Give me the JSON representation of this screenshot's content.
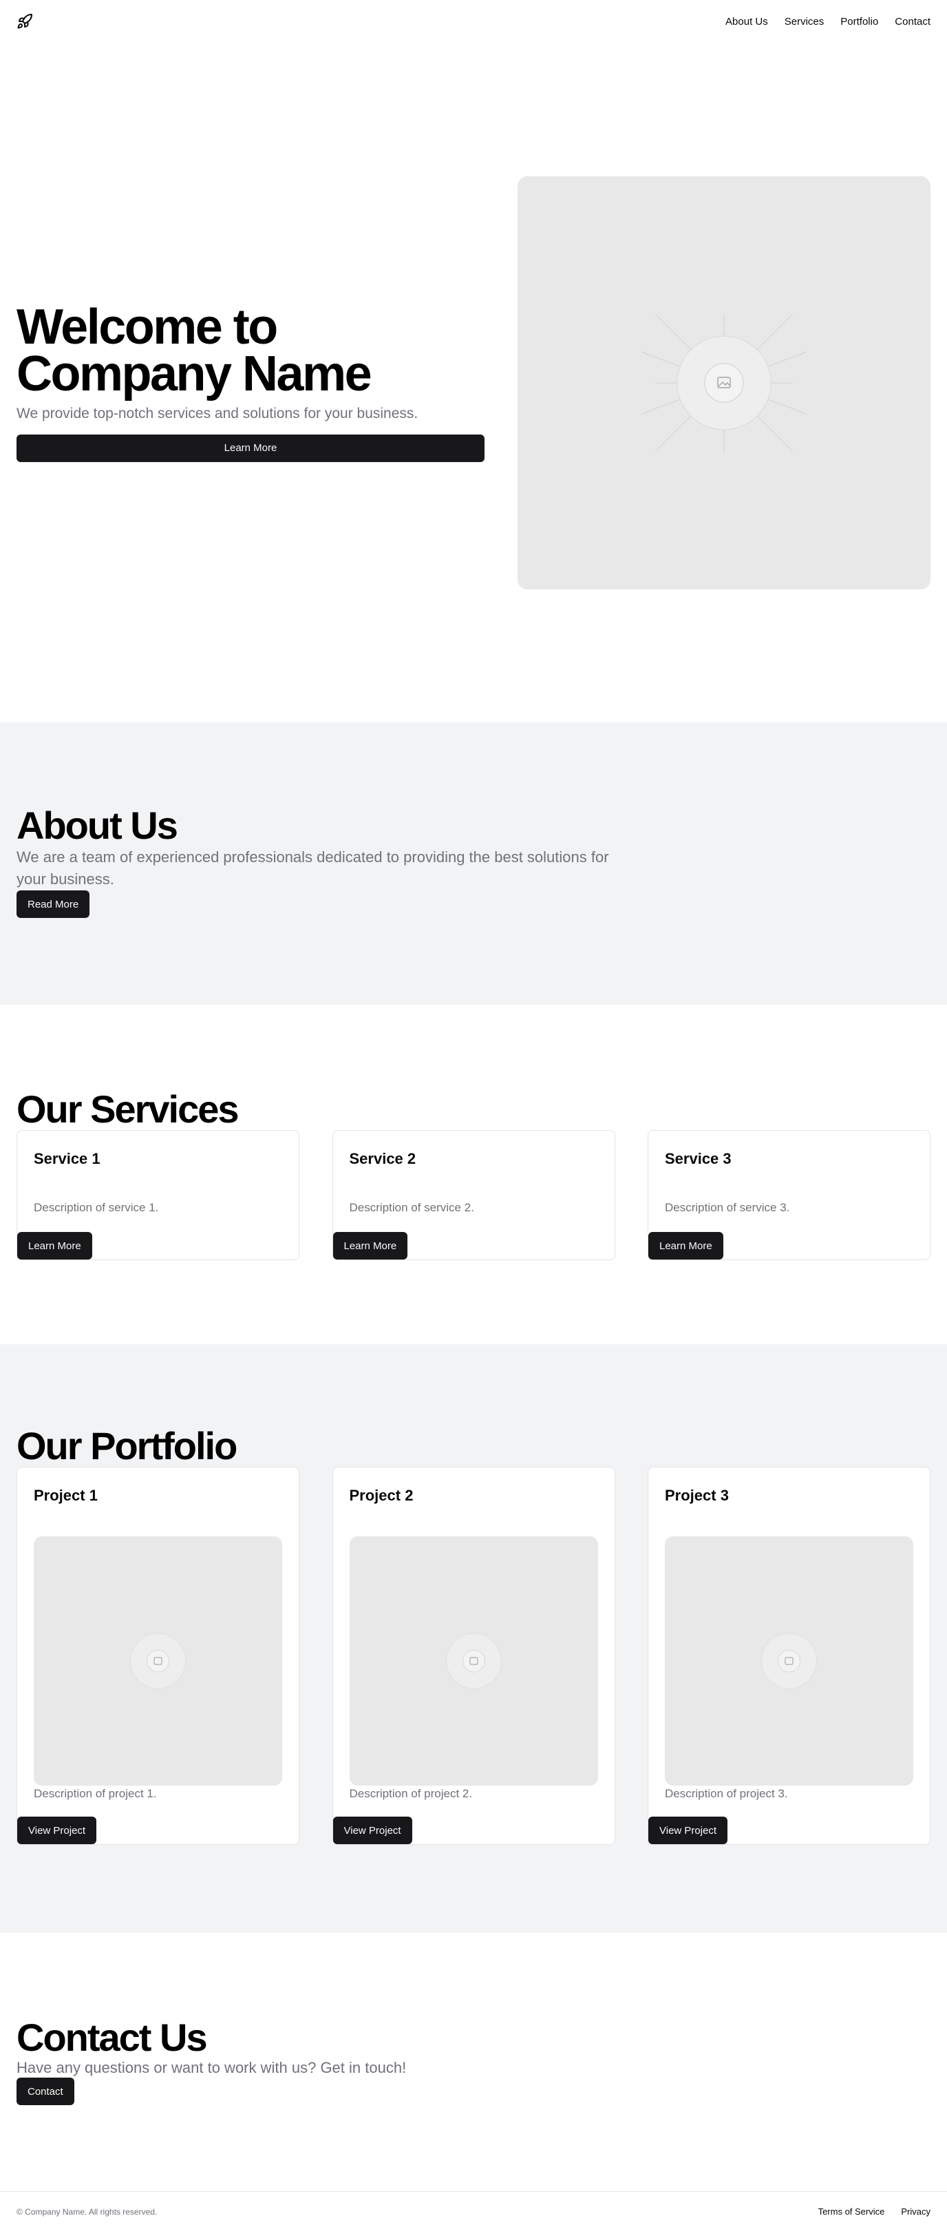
{
  "nav": {
    "items": [
      {
        "label": "About Us"
      },
      {
        "label": "Services"
      },
      {
        "label": "Portfolio"
      },
      {
        "label": "Contact"
      }
    ]
  },
  "hero": {
    "title": "Welcome to Company Name",
    "subtitle": "We provide top-notch services and solutions for your business.",
    "button": "Learn More",
    "image_icon": "image-placeholder-icon"
  },
  "about": {
    "title": "About Us",
    "text": "We are a team of experienced professionals dedicated to providing the best solutions for your business.",
    "button": "Read More"
  },
  "services": {
    "title": "Our Services",
    "items": [
      {
        "title": "Service 1",
        "description": "Description of service 1.",
        "button": "Learn More"
      },
      {
        "title": "Service 2",
        "description": "Description of service 2.",
        "button": "Learn More"
      },
      {
        "title": "Service 3",
        "description": "Description of service 3.",
        "button": "Learn More"
      }
    ]
  },
  "portfolio": {
    "title": "Our Portfolio",
    "items": [
      {
        "title": "Project 1",
        "description": "Description of project 1.",
        "button": "View Project"
      },
      {
        "title": "Project 2",
        "description": "Description of project 2.",
        "button": "View Project"
      },
      {
        "title": "Project 3",
        "description": "Description of project 3.",
        "button": "View Project"
      }
    ]
  },
  "contact": {
    "title": "Contact Us",
    "subtitle": "Have any questions or want to work with us? Get in touch!",
    "button": "Contact"
  },
  "footer": {
    "copyright": "© Company Name. All rights reserved.",
    "links": [
      {
        "label": "Terms of Service"
      },
      {
        "label": "Privacy"
      }
    ]
  },
  "colors": {
    "primary": "#18181b",
    "muted_text": "#71717a",
    "section_gray": "#f2f3f5",
    "placeholder": "#e8e8e8",
    "border": "#e4e4e7"
  }
}
